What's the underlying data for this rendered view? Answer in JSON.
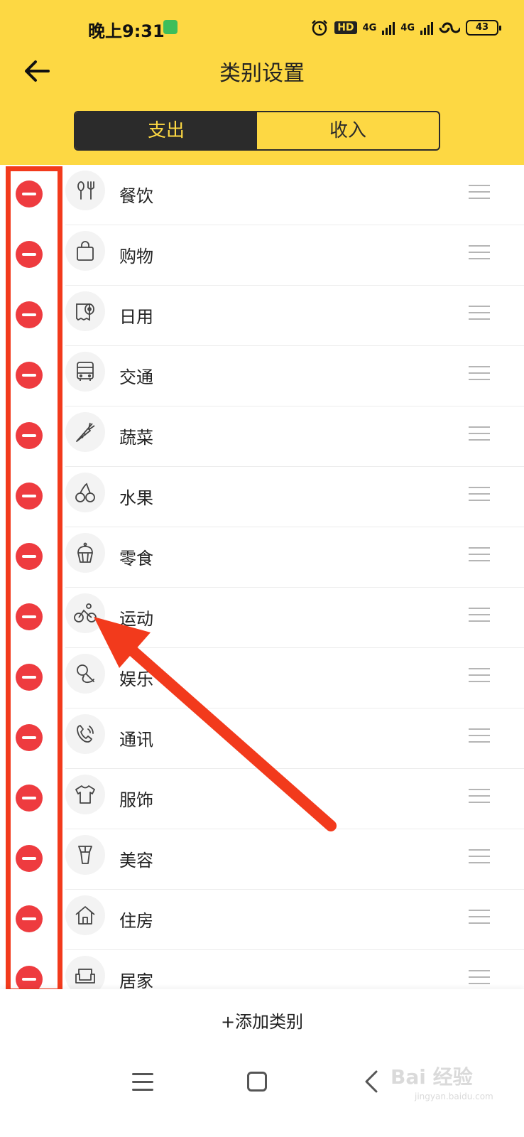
{
  "status_bar": {
    "time": "晚上9:31",
    "hd_label": "HD",
    "network_1": "4G",
    "network_2": "4G",
    "battery": "43"
  },
  "header": {
    "back_icon": "arrow-left-icon",
    "title": "类别设置"
  },
  "tabs": [
    {
      "label": "支出",
      "active": true
    },
    {
      "label": "收入",
      "active": false
    }
  ],
  "categories": [
    {
      "label": "餐饮",
      "icon": "utensils-icon"
    },
    {
      "label": "购物",
      "icon": "shopping-bag-icon"
    },
    {
      "label": "日用",
      "icon": "tissue-roll-icon"
    },
    {
      "label": "交通",
      "icon": "bus-icon"
    },
    {
      "label": "蔬菜",
      "icon": "carrot-icon"
    },
    {
      "label": "水果",
      "icon": "cherry-icon"
    },
    {
      "label": "零食",
      "icon": "cupcake-icon"
    },
    {
      "label": "运动",
      "icon": "bicycle-icon"
    },
    {
      "label": "娱乐",
      "icon": "microphone-icon"
    },
    {
      "label": "通讯",
      "icon": "phone-icon"
    },
    {
      "label": "服饰",
      "icon": "tshirt-icon"
    },
    {
      "label": "美容",
      "icon": "makeup-brush-icon"
    },
    {
      "label": "住房",
      "icon": "house-icon"
    },
    {
      "label": "居家",
      "icon": "sofa-icon"
    }
  ],
  "footer": {
    "add_label": "+添加类别"
  },
  "watermark": {
    "text": "Bai 经验",
    "url_text": "jingyan.baidu.com"
  },
  "colors": {
    "header_bg": "#FDD843",
    "delete_red": "#EE3B3F",
    "annotation_red": "#F23A1C",
    "tab_dark": "#2B2B2B"
  }
}
